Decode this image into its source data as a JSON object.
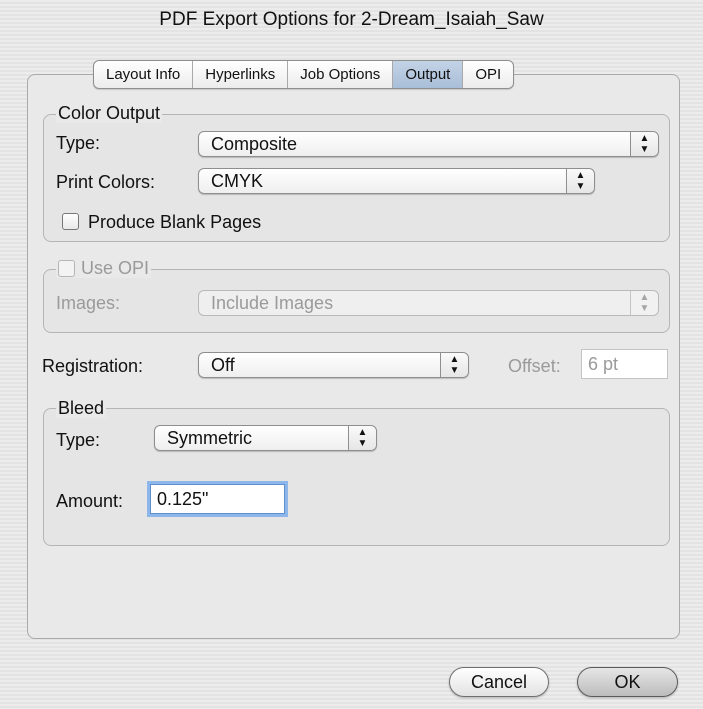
{
  "window": {
    "title": "PDF Export Options for 2-Dream_Isaiah_Saw"
  },
  "tabs": [
    {
      "label": "Layout Info",
      "active": false
    },
    {
      "label": "Hyperlinks",
      "active": false
    },
    {
      "label": "Job Options",
      "active": false
    },
    {
      "label": "Output",
      "active": true
    },
    {
      "label": "OPI",
      "active": false
    }
  ],
  "color_output": {
    "legend": "Color Output",
    "type_label": "Type:",
    "type_value": "Composite",
    "print_colors_label": "Print Colors:",
    "print_colors_value": "CMYK",
    "blank_pages_label": "Produce Blank Pages",
    "blank_pages_checked": false
  },
  "opi": {
    "checkbox_label": "Use OPI",
    "enabled": false,
    "images_label": "Images:",
    "images_value": "Include Images"
  },
  "registration": {
    "label": "Registration:",
    "value": "Off",
    "offset_label": "Offset:",
    "offset_value": "6 pt"
  },
  "bleed": {
    "legend": "Bleed",
    "type_label": "Type:",
    "type_value": "Symmetric",
    "amount_label": "Amount:",
    "amount_value": "0.125\""
  },
  "buttons": {
    "cancel": "Cancel",
    "ok": "OK"
  },
  "icons": {
    "popup_arrows": "▲▼"
  },
  "colors": {
    "active_tab": "#a9bed8",
    "focus": "#cfe3fb"
  }
}
